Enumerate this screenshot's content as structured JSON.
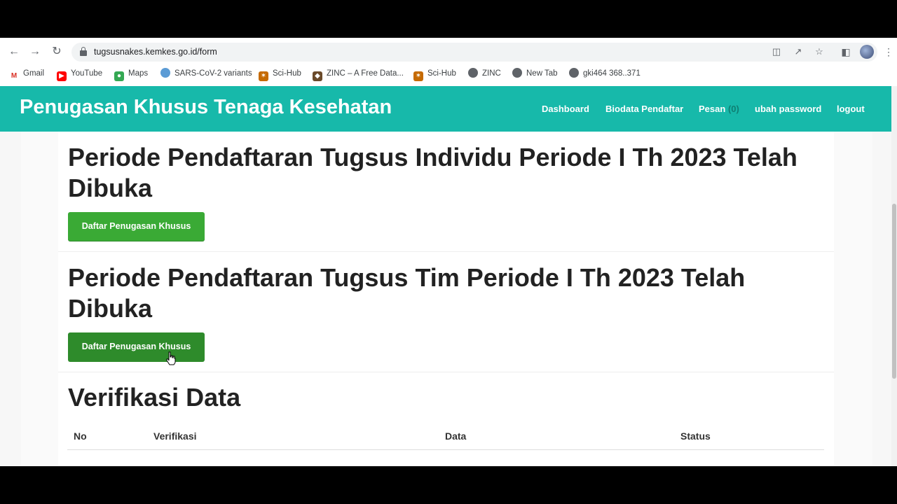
{
  "browser": {
    "url": "tugsusnakes.kemkes.go.id/form",
    "bookmarks": [
      "Gmail",
      "YouTube",
      "Maps",
      "SARS-CoV-2 variants",
      "Sci-Hub",
      "ZINC – A Free Data...",
      "Sci-Hub",
      "ZINC",
      "New Tab",
      "gki464 368..371"
    ],
    "icons": [
      "back-arrow-icon",
      "forward-arrow-icon",
      "reload-icon",
      "lock-icon",
      "translate-icon",
      "share-icon",
      "star-icon",
      "side-panel-icon",
      "profile-avatar",
      "more-vert-icon"
    ]
  },
  "site": {
    "title": "Penugasan Khusus Tenaga Kesehatan",
    "nav": {
      "dashboard": "Dashboard",
      "biodata": "Biodata Pendaftar",
      "pesan": "Pesan",
      "pesan_count": "(0)",
      "password": "ubah password",
      "logout": "logout"
    },
    "accent_color": "#17b9aa",
    "button_color": "#3aaa35"
  },
  "sections": [
    {
      "heading": "Periode Pendaftaran Tugsus Individu Periode I Th 2023 Telah Dibuka",
      "button": "Daftar Penugasan Khusus"
    },
    {
      "heading": "Periode Pendaftaran Tugsus Tim Periode I Th 2023 Telah Dibuka",
      "button": "Daftar Penugasan Khusus"
    }
  ],
  "verification": {
    "heading": "Verifikasi Data",
    "columns": [
      "No",
      "Verifikasi",
      "Data",
      "Status"
    ]
  }
}
